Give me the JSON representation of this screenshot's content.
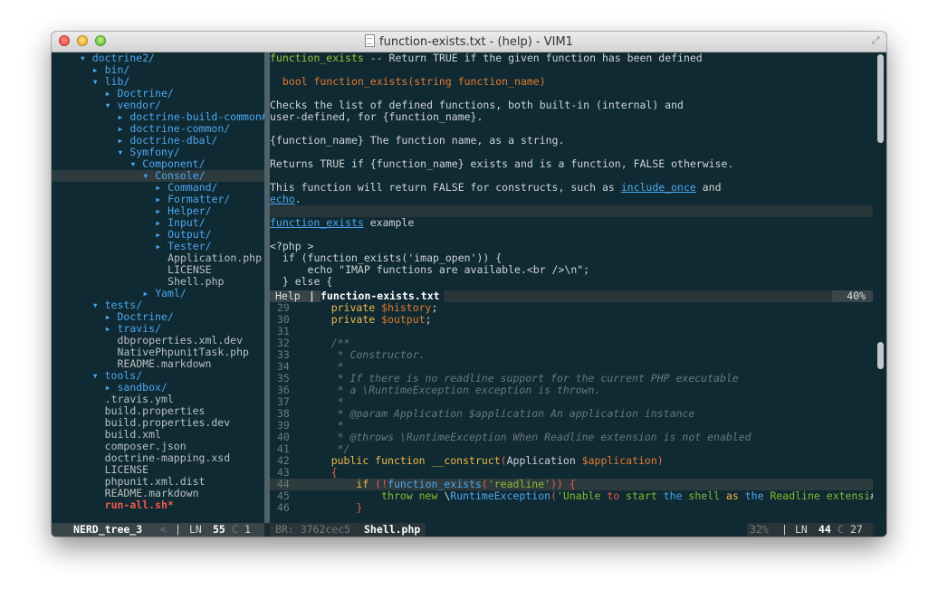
{
  "window": {
    "title": "function-exists.txt - (help) - VIM1"
  },
  "tree": [
    {
      "text": "▾ doctrine2/",
      "indent": 3,
      "kind": "dir"
    },
    {
      "text": "▸ bin/",
      "indent": 5,
      "kind": "dir"
    },
    {
      "text": "▾ lib/",
      "indent": 5,
      "kind": "dir"
    },
    {
      "text": "▸ Doctrine/",
      "indent": 7,
      "kind": "dir"
    },
    {
      "text": "▾ vendor/",
      "indent": 7,
      "kind": "dir"
    },
    {
      "text": "▸ doctrine-build-common#",
      "indent": 9,
      "kind": "dir"
    },
    {
      "text": "▸ doctrine-common/",
      "indent": 9,
      "kind": "dir"
    },
    {
      "text": "▸ doctrine-dbal/",
      "indent": 9,
      "kind": "dir"
    },
    {
      "text": "▾ Symfony/",
      "indent": 9,
      "kind": "dir"
    },
    {
      "text": "▾ Component/",
      "indent": 11,
      "kind": "dir"
    },
    {
      "text": "▾ Console/",
      "indent": 13,
      "kind": "dir",
      "highlight": true
    },
    {
      "text": "▸ Command/",
      "indent": 15,
      "kind": "dir"
    },
    {
      "text": "▸ Formatter/",
      "indent": 15,
      "kind": "dir"
    },
    {
      "text": "▸ Helper/",
      "indent": 15,
      "kind": "dir"
    },
    {
      "text": "▸ Input/",
      "indent": 15,
      "kind": "dir"
    },
    {
      "text": "▸ Output/",
      "indent": 15,
      "kind": "dir"
    },
    {
      "text": "▸ Tester/",
      "indent": 15,
      "kind": "dir"
    },
    {
      "text": "Application.php",
      "indent": 17,
      "kind": "file"
    },
    {
      "text": "LICENSE",
      "indent": 17,
      "kind": "file"
    },
    {
      "text": "Shell.php",
      "indent": 17,
      "kind": "file"
    },
    {
      "text": "▸ Yaml/",
      "indent": 13,
      "kind": "dir"
    },
    {
      "text": "▾ tests/",
      "indent": 5,
      "kind": "dir"
    },
    {
      "text": "▸ Doctrine/",
      "indent": 7,
      "kind": "dir"
    },
    {
      "text": "▸ travis/",
      "indent": 7,
      "kind": "dir"
    },
    {
      "text": "dbproperties.xml.dev",
      "indent": 9,
      "kind": "file"
    },
    {
      "text": "NativePhpunitTask.php",
      "indent": 9,
      "kind": "file"
    },
    {
      "text": "README.markdown",
      "indent": 9,
      "kind": "file"
    },
    {
      "text": "▾ tools/",
      "indent": 5,
      "kind": "dir"
    },
    {
      "text": "▸ sandbox/",
      "indent": 7,
      "kind": "dir"
    },
    {
      "text": ".travis.yml",
      "indent": 7,
      "kind": "file"
    },
    {
      "text": "build.properties",
      "indent": 7,
      "kind": "file"
    },
    {
      "text": "build.properties.dev",
      "indent": 7,
      "kind": "file"
    },
    {
      "text": "build.xml",
      "indent": 7,
      "kind": "file"
    },
    {
      "text": "composer.json",
      "indent": 7,
      "kind": "file"
    },
    {
      "text": "doctrine-mapping.xsd",
      "indent": 7,
      "kind": "file"
    },
    {
      "text": "LICENSE",
      "indent": 7,
      "kind": "file"
    },
    {
      "text": "phpunit.xml.dist",
      "indent": 7,
      "kind": "file"
    },
    {
      "text": "README.markdown",
      "indent": 7,
      "kind": "file"
    },
    {
      "text": "run-all.sh*",
      "indent": 7,
      "kind": "exec"
    }
  ],
  "help": {
    "l1_name": "function_exists",
    "l1_rest": " -- Return TRUE if the given function has been defined",
    "l3": "  bool function_exists(string function_name)",
    "l5": "Checks the list of defined functions, both built-in (internal) and",
    "l6": "user-defined, for {function_name}.",
    "l8": "{function_name} The function name, as a string.",
    "l10": "Returns TRUE if {function_name} exists and is a function, FALSE otherwise.",
    "l12a": "This function will return FALSE for constructs, such as ",
    "l12link": "include_once",
    "l12b": " and",
    "l13link": "echo",
    "l13b": ".",
    "l15link": "function_exists",
    "l15b": " example",
    "l17": "<?php >",
    "l18": "  if (function_exists('imap_open')) {",
    "l19": "      echo \"IMAP functions are available.<br />\\n\";",
    "l20": "  } else {"
  },
  "help_status": {
    "mode": "Help",
    "sep": "|",
    "file": "function-exists.txt",
    "percent": "40%"
  },
  "code": [
    {
      "n": "29",
      "parts": [
        [
          "pl",
          "    "
        ],
        [
          "kw",
          "private "
        ],
        [
          "var",
          "$history"
        ],
        [
          "pl",
          ";"
        ]
      ]
    },
    {
      "n": "30",
      "parts": [
        [
          "pl",
          "    "
        ],
        [
          "kw",
          "private "
        ],
        [
          "var",
          "$output"
        ],
        [
          "pl",
          ";"
        ]
      ]
    },
    {
      "n": "31",
      "parts": []
    },
    {
      "n": "32",
      "parts": [
        [
          "cm",
          "    /**"
        ]
      ]
    },
    {
      "n": "33",
      "parts": [
        [
          "cm",
          "     * Constructor."
        ]
      ]
    },
    {
      "n": "34",
      "parts": [
        [
          "cm",
          "     *"
        ]
      ]
    },
    {
      "n": "35",
      "parts": [
        [
          "cm",
          "     * If there is no readline support for the current PHP executable"
        ]
      ]
    },
    {
      "n": "36",
      "parts": [
        [
          "cm",
          "     * a \\RuntimeException exception is thrown."
        ]
      ]
    },
    {
      "n": "37",
      "parts": [
        [
          "cm",
          "     *"
        ]
      ]
    },
    {
      "n": "38",
      "parts": [
        [
          "cm",
          "     * @param Application $application An application instance"
        ]
      ]
    },
    {
      "n": "39",
      "parts": [
        [
          "cm",
          "     *"
        ]
      ]
    },
    {
      "n": "40",
      "parts": [
        [
          "cm",
          "     * @throws \\RuntimeException When Readline extension is not enabled"
        ]
      ]
    },
    {
      "n": "41",
      "parts": [
        [
          "cm",
          "     */"
        ]
      ]
    },
    {
      "n": "42",
      "parts": [
        [
          "pl",
          "    "
        ],
        [
          "kw",
          "public function "
        ],
        [
          "fn",
          "__construct"
        ],
        [
          "red2",
          "("
        ],
        [
          "pl",
          "Application "
        ],
        [
          "var",
          "$application"
        ],
        [
          "red2",
          ")"
        ]
      ]
    },
    {
      "n": "43",
      "parts": [
        [
          "pl",
          "    "
        ],
        [
          "red2",
          "{"
        ]
      ]
    },
    {
      "n": "44",
      "parts": [
        [
          "pl",
          "        "
        ],
        [
          "kw",
          "if "
        ],
        [
          "red2",
          "(!"
        ],
        [
          "cls",
          "function_exists"
        ],
        [
          "red2",
          "("
        ],
        [
          "str",
          "'readline'"
        ],
        [
          "red2",
          ")) {"
        ]
      ],
      "highlight": true
    },
    {
      "n": "45",
      "parts": [
        [
          "pl",
          "            "
        ],
        [
          "str",
          "throw new "
        ],
        [
          "pl",
          "\\"
        ],
        [
          "cls",
          "RuntimeException"
        ],
        [
          "red2",
          "("
        ],
        [
          "str",
          "'Unable "
        ],
        [
          "red2",
          "to "
        ],
        [
          "str",
          "start "
        ],
        [
          "cls",
          "the "
        ],
        [
          "str",
          "shell "
        ],
        [
          "kw",
          "as "
        ],
        [
          "cls",
          "the "
        ],
        [
          "str",
          "Readline extensi"
        ],
        [
          "pl",
          "#"
        ]
      ]
    },
    {
      "n": "46",
      "parts": [
        [
          "pl",
          "        "
        ],
        [
          "red2",
          "}"
        ]
      ]
    }
  ],
  "status_left": {
    "name": "NERD_tree_3",
    "arrow": "<",
    "sep": "|",
    "ln_label": "LN",
    "ln": "55",
    "col_label": "C",
    "col": "1"
  },
  "status_right": {
    "branch": "BR: 3762cec5",
    "file": "Shell.php",
    "percent": "32%",
    "sep": "|",
    "ln_label": "LN",
    "ln": "44",
    "col_label": "C",
    "col": "27"
  }
}
